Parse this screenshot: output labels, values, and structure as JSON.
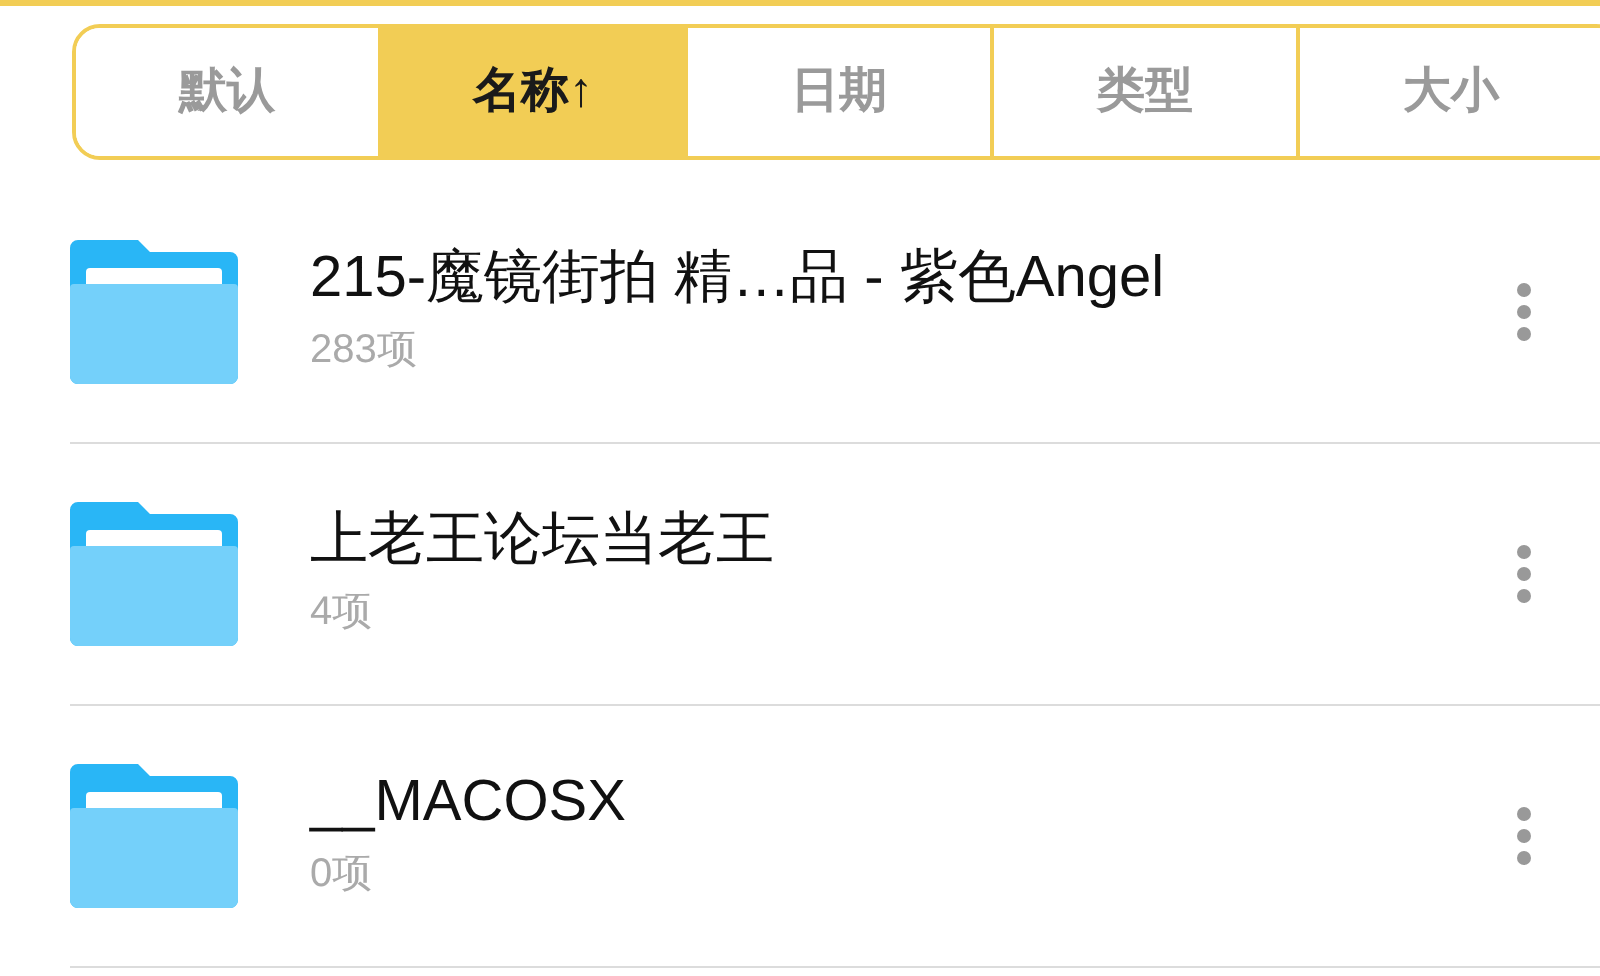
{
  "sort_tabs": [
    {
      "label": "默认",
      "selected": false
    },
    {
      "label": "名称↑",
      "selected": true
    },
    {
      "label": "日期",
      "selected": false
    },
    {
      "label": "类型",
      "selected": false
    },
    {
      "label": "大小",
      "selected": false
    }
  ],
  "files": [
    {
      "name": "215-魔镜街拍 精…品 - 紫色Angel",
      "count": "283项"
    },
    {
      "name": "上老王论坛当老王",
      "count": "4项"
    },
    {
      "name": "__MACOSX",
      "count": "0项"
    }
  ]
}
